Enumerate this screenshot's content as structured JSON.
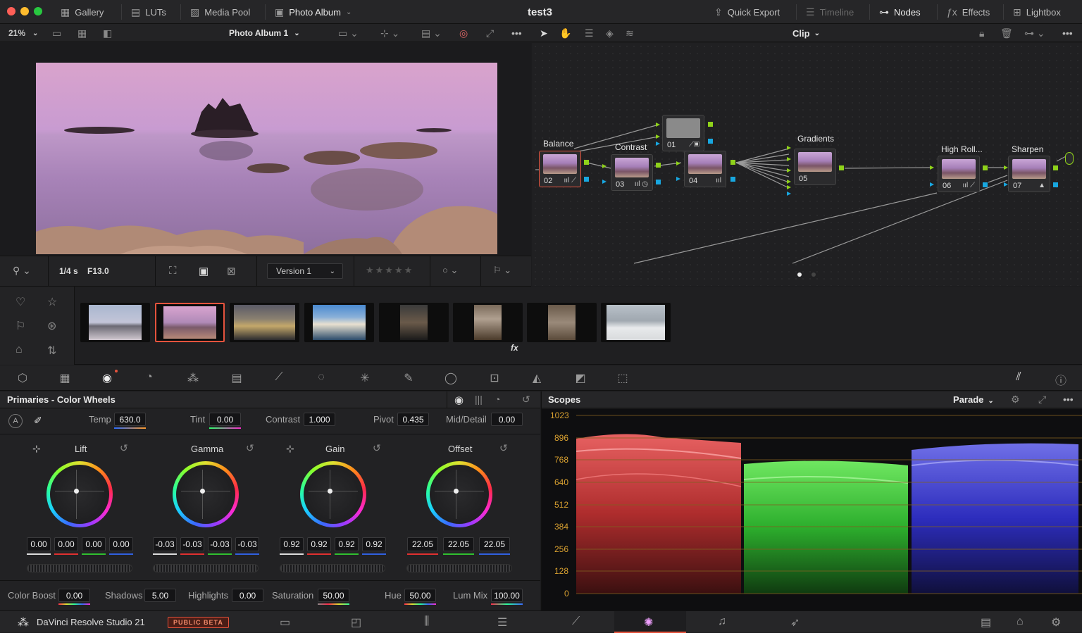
{
  "titlebar": {
    "project_title": "test3",
    "gallery": "Gallery",
    "luts": "LUTs",
    "media_pool": "Media Pool",
    "photo_album": "Photo Album",
    "quick_export": "Quick Export",
    "timeline": "Timeline",
    "nodes": "Nodes",
    "effects": "Effects",
    "lightbox": "Lightbox"
  },
  "toolbar": {
    "zoom": "21%",
    "album_name": "Photo Album 1",
    "node_mode": "Clip"
  },
  "viewer_bar": {
    "shutter": "1/4 s",
    "aperture": "F13.0",
    "version": "Version 1",
    "rating_stars": "★★★★★"
  },
  "nodes": {
    "labels": {
      "balance": "Balance",
      "contrast": "Contrast",
      "gradients": "Gradients",
      "high_roll": "High Roll...",
      "sharpen": "Sharpen"
    },
    "numbers": {
      "n01": "01",
      "n02": "02",
      "n03": "03",
      "n04": "04",
      "n05": "05",
      "n06": "06",
      "n07": "07"
    }
  },
  "gallery": {
    "fx_label": "fx",
    "thumb_count": 8,
    "selected_index": 1
  },
  "primaries": {
    "title": "Primaries - Color Wheels",
    "temp_label": "Temp",
    "temp": "630.0",
    "tint_label": "Tint",
    "tint": "0.00",
    "contrast_label": "Contrast",
    "contrast": "1.000",
    "pivot_label": "Pivot",
    "pivot": "0.435",
    "middetail_label": "Mid/Detail",
    "middetail": "0.00",
    "auto_badge": "A",
    "wheels": {
      "lift": {
        "title": "Lift",
        "v": [
          "0.00",
          "0.00",
          "0.00",
          "0.00"
        ]
      },
      "gamma": {
        "title": "Gamma",
        "v": [
          "-0.03",
          "-0.03",
          "-0.03",
          "-0.03"
        ]
      },
      "gain": {
        "title": "Gain",
        "v": [
          "0.92",
          "0.92",
          "0.92",
          "0.92"
        ]
      },
      "offset": {
        "title": "Offset",
        "v": [
          "22.05",
          "22.05",
          "22.05"
        ]
      }
    },
    "bottom": {
      "color_boost_label": "Color Boost",
      "color_boost": "0.00",
      "shadows_label": "Shadows",
      "shadows": "5.00",
      "highlights_label": "Highlights",
      "highlights": "0.00",
      "saturation_label": "Saturation",
      "saturation": "50.00",
      "hue_label": "Hue",
      "hue": "50.00",
      "lum_mix_label": "Lum Mix",
      "lum_mix": "100.00"
    }
  },
  "scopes": {
    "title": "Scopes",
    "mode": "Parade",
    "ticks": [
      "1023",
      "896",
      "768",
      "640",
      "512",
      "384",
      "256",
      "128",
      "0"
    ]
  },
  "status": {
    "app_name": "DaVinci Resolve Studio 21",
    "beta_badge": "PUBLIC BETA"
  },
  "colors": {
    "accent_red": "#e5533d",
    "node_green": "#8fd21a",
    "node_blue": "#18a7e0"
  }
}
